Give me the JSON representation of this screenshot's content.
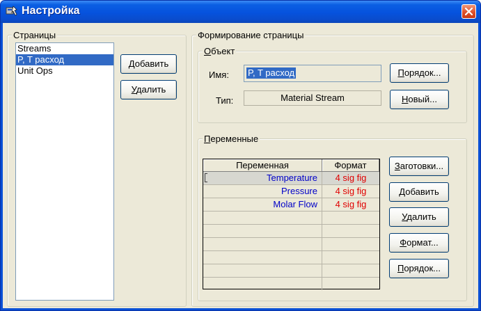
{
  "window": {
    "title": "Настройка"
  },
  "pages_group": {
    "label": "Страницы",
    "items": [
      "Streams",
      "P, T расход",
      "Unit Ops"
    ],
    "selected_index": 1,
    "add_button": "Добавить",
    "delete_button": "Удалить"
  },
  "form_group": {
    "label": "Формирование страницы",
    "object": {
      "label": "Объект",
      "name_label": "Имя:",
      "name_value": "P, T расход",
      "type_label": "Тип:",
      "type_value": "Material Stream",
      "order_button": "Порядок...",
      "new_button": "Новый..."
    },
    "variables": {
      "label": "Переменные",
      "columns": [
        "Переменная",
        "Формат"
      ],
      "rows": [
        {
          "variable": "Temperature",
          "format": "4 sig fig"
        },
        {
          "variable": "Pressure",
          "format": "4 sig fig"
        },
        {
          "variable": "Molar Flow",
          "format": "4 sig fig"
        }
      ],
      "buttons": {
        "presets": "Заготовки...",
        "add": "Добавить",
        "delete": "Удалить",
        "format": "Формат...",
        "order": "Порядок..."
      }
    }
  },
  "colors": {
    "title_bar": "#0652dd",
    "selection": "#316ac5",
    "variable_text": "#0000c8",
    "format_text": "#e00000"
  },
  "icons": {
    "title": "settings-window-icon",
    "close": "close-icon"
  }
}
